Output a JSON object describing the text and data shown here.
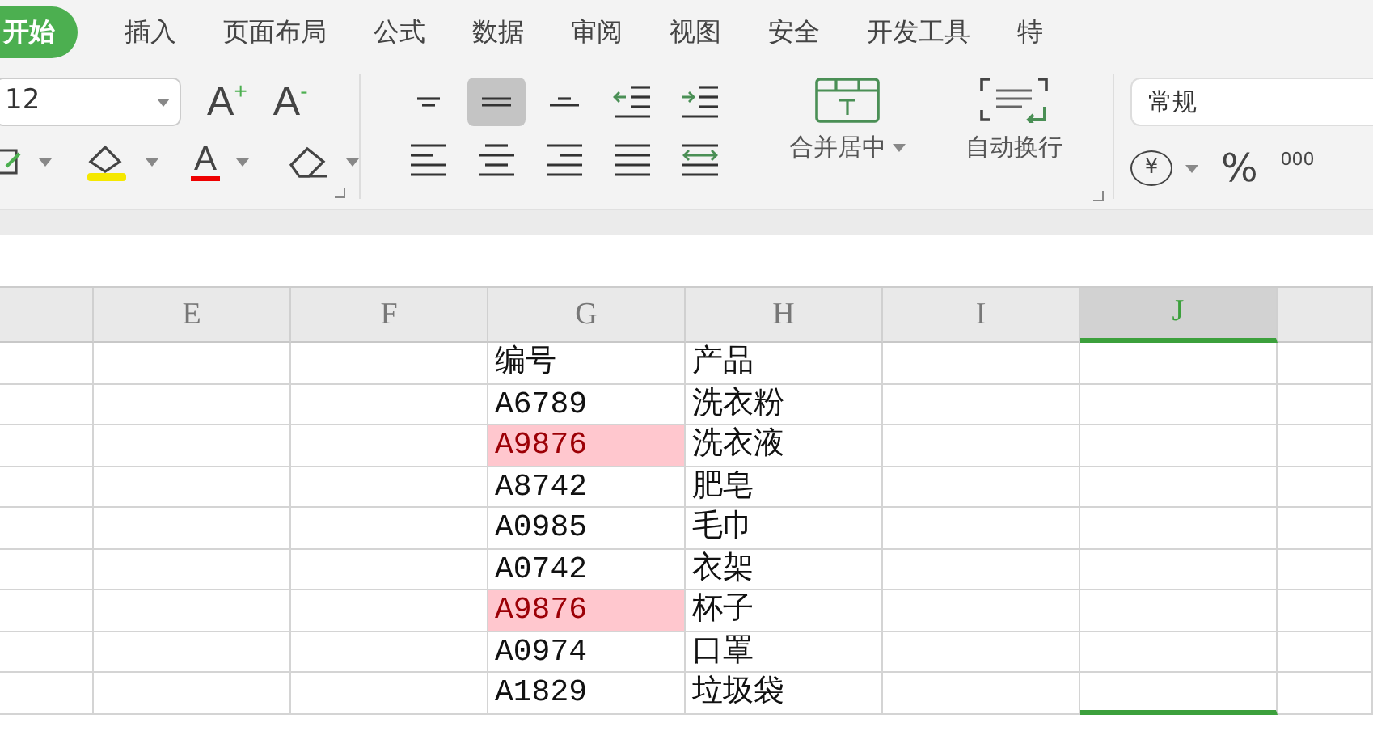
{
  "tabs": [
    {
      "label": "开始",
      "selected": true
    },
    {
      "label": "插入",
      "selected": false
    },
    {
      "label": "页面布局",
      "selected": false
    },
    {
      "label": "公式",
      "selected": false
    },
    {
      "label": "数据",
      "selected": false
    },
    {
      "label": "审阅",
      "selected": false
    },
    {
      "label": "视图",
      "selected": false
    },
    {
      "label": "安全",
      "selected": false
    },
    {
      "label": "开发工具",
      "selected": false
    },
    {
      "label": "特",
      "selected": false
    }
  ],
  "ribbon": {
    "font_size": "12",
    "grow_font": "A$^{+}$",
    "shrink_font": "A$^{-}$",
    "font_color": "A",
    "merge_label": "合并居中",
    "wrap_label": "自动换行",
    "number_format": "常规",
    "currency": "¥",
    "percent": "%",
    "thousands": "000"
  },
  "alignment": [
    {
      "kind": "top",
      "selected": false
    },
    {
      "kind": "middle",
      "selected": true
    },
    {
      "kind": "bottom",
      "selected": false
    },
    {
      "kind": "outdent",
      "selected": false
    },
    {
      "kind": "indent",
      "selected": false
    },
    {
      "kind": "left",
      "selected": false
    },
    {
      "kind": "center",
      "selected": false
    },
    {
      "kind": "right",
      "selected": false
    },
    {
      "kind": "justify",
      "selected": false
    },
    {
      "kind": "distributed",
      "selected": false
    }
  ],
  "columns": [
    {
      "selected": false
    },
    {
      "label": "E",
      "selected": false
    },
    {
      "label": "F",
      "selected": false
    },
    {
      "label": "G",
      "selected": false
    },
    {
      "label": "H",
      "selected": false
    },
    {
      "label": "I",
      "selected": false
    },
    {
      "label": "J",
      "selected": true
    },
    {
      "selected": false
    }
  ],
  "rows": [
    {
      "cells": [
        "编号",
        "产品"
      ],
      "duplicate": false
    },
    {
      "cells": [
        "A6789",
        "洗衣粉"
      ],
      "duplicate": false
    },
    {
      "cells": [
        "A9876",
        "洗衣液"
      ],
      "duplicate": true
    },
    {
      "cells": [
        "A8742",
        "肥皂"
      ],
      "duplicate": false
    },
    {
      "cells": [
        "A0985",
        "毛巾"
      ],
      "duplicate": false
    },
    {
      "cells": [
        "A0742",
        "衣架"
      ],
      "duplicate": false
    },
    {
      "cells": [
        "A9876",
        "杯子"
      ],
      "duplicate": true
    },
    {
      "cells": [
        "A0974",
        "口罩"
      ],
      "duplicate": false
    },
    {
      "cells": [
        "A1829",
        "垃圾袋"
      ],
      "duplicate": false
    }
  ]
}
